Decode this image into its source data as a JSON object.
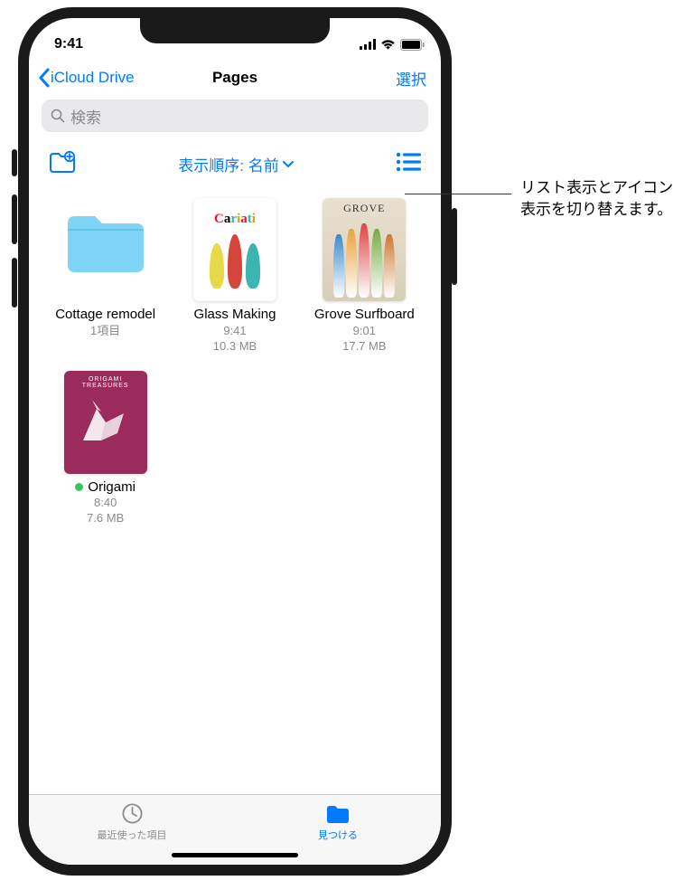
{
  "status": {
    "time": "9:41"
  },
  "nav": {
    "back": "iCloud Drive",
    "title": "Pages",
    "select": "選択"
  },
  "search": {
    "placeholder": "検索"
  },
  "toolbar": {
    "sort": "表示順序: 名前"
  },
  "items": [
    {
      "name": "Cottage remodel",
      "meta1": "1項目",
      "meta2": ""
    },
    {
      "name": "Glass Making",
      "meta1": "9:41",
      "meta2": "10.3 MB"
    },
    {
      "name": "Grove Surfboard",
      "meta1": "9:01",
      "meta2": "17.7 MB"
    },
    {
      "name": "Origami",
      "meta1": "8:40",
      "meta2": "7.6 MB"
    }
  ],
  "tabs": {
    "recent": "最近使った項目",
    "browse": "見つける"
  },
  "thumb_labels": {
    "grove": "GROVE",
    "origami1": "ORIGAMI",
    "origami2": "TREASURES"
  },
  "callout": "リスト表示とアイコン表示を切り替えます。"
}
